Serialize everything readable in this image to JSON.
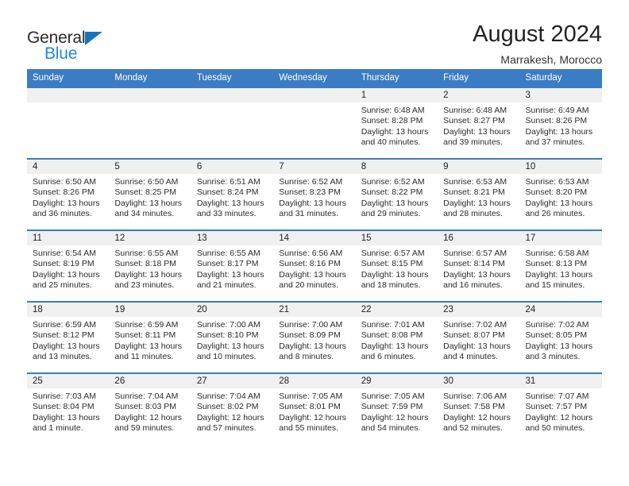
{
  "brand": {
    "name_part1": "General",
    "name_part2": "Blue",
    "logo_icon": "triangle-logo-icon"
  },
  "header": {
    "title": "August 2024",
    "location": "Marrakesh, Morocco"
  },
  "colors": {
    "header_blue": "#3b7cc4",
    "brand_blue": "#2189d6",
    "daynum_band": "#f0f0f0"
  },
  "weekday_headers": [
    "Sunday",
    "Monday",
    "Tuesday",
    "Wednesday",
    "Thursday",
    "Friday",
    "Saturday"
  ],
  "labels": {
    "sunrise_prefix": "Sunrise:",
    "sunset_prefix": "Sunset:",
    "daylight_prefix": "Daylight:"
  },
  "weeks": [
    [
      {
        "day": "",
        "empty": true
      },
      {
        "day": "",
        "empty": true
      },
      {
        "day": "",
        "empty": true
      },
      {
        "day": "",
        "empty": true
      },
      {
        "day": "1",
        "sunrise": "Sunrise: 6:48 AM",
        "sunset": "Sunset: 8:28 PM",
        "daylight1": "Daylight: 13 hours",
        "daylight2": "and 40 minutes."
      },
      {
        "day": "2",
        "sunrise": "Sunrise: 6:48 AM",
        "sunset": "Sunset: 8:27 PM",
        "daylight1": "Daylight: 13 hours",
        "daylight2": "and 39 minutes."
      },
      {
        "day": "3",
        "sunrise": "Sunrise: 6:49 AM",
        "sunset": "Sunset: 8:26 PM",
        "daylight1": "Daylight: 13 hours",
        "daylight2": "and 37 minutes."
      }
    ],
    [
      {
        "day": "4",
        "sunrise": "Sunrise: 6:50 AM",
        "sunset": "Sunset: 8:26 PM",
        "daylight1": "Daylight: 13 hours",
        "daylight2": "and 36 minutes."
      },
      {
        "day": "5",
        "sunrise": "Sunrise: 6:50 AM",
        "sunset": "Sunset: 8:25 PM",
        "daylight1": "Daylight: 13 hours",
        "daylight2": "and 34 minutes."
      },
      {
        "day": "6",
        "sunrise": "Sunrise: 6:51 AM",
        "sunset": "Sunset: 8:24 PM",
        "daylight1": "Daylight: 13 hours",
        "daylight2": "and 33 minutes."
      },
      {
        "day": "7",
        "sunrise": "Sunrise: 6:52 AM",
        "sunset": "Sunset: 8:23 PM",
        "daylight1": "Daylight: 13 hours",
        "daylight2": "and 31 minutes."
      },
      {
        "day": "8",
        "sunrise": "Sunrise: 6:52 AM",
        "sunset": "Sunset: 8:22 PM",
        "daylight1": "Daylight: 13 hours",
        "daylight2": "and 29 minutes."
      },
      {
        "day": "9",
        "sunrise": "Sunrise: 6:53 AM",
        "sunset": "Sunset: 8:21 PM",
        "daylight1": "Daylight: 13 hours",
        "daylight2": "and 28 minutes."
      },
      {
        "day": "10",
        "sunrise": "Sunrise: 6:53 AM",
        "sunset": "Sunset: 8:20 PM",
        "daylight1": "Daylight: 13 hours",
        "daylight2": "and 26 minutes."
      }
    ],
    [
      {
        "day": "11",
        "sunrise": "Sunrise: 6:54 AM",
        "sunset": "Sunset: 8:19 PM",
        "daylight1": "Daylight: 13 hours",
        "daylight2": "and 25 minutes."
      },
      {
        "day": "12",
        "sunrise": "Sunrise: 6:55 AM",
        "sunset": "Sunset: 8:18 PM",
        "daylight1": "Daylight: 13 hours",
        "daylight2": "and 23 minutes."
      },
      {
        "day": "13",
        "sunrise": "Sunrise: 6:55 AM",
        "sunset": "Sunset: 8:17 PM",
        "daylight1": "Daylight: 13 hours",
        "daylight2": "and 21 minutes."
      },
      {
        "day": "14",
        "sunrise": "Sunrise: 6:56 AM",
        "sunset": "Sunset: 8:16 PM",
        "daylight1": "Daylight: 13 hours",
        "daylight2": "and 20 minutes."
      },
      {
        "day": "15",
        "sunrise": "Sunrise: 6:57 AM",
        "sunset": "Sunset: 8:15 PM",
        "daylight1": "Daylight: 13 hours",
        "daylight2": "and 18 minutes."
      },
      {
        "day": "16",
        "sunrise": "Sunrise: 6:57 AM",
        "sunset": "Sunset: 8:14 PM",
        "daylight1": "Daylight: 13 hours",
        "daylight2": "and 16 minutes."
      },
      {
        "day": "17",
        "sunrise": "Sunrise: 6:58 AM",
        "sunset": "Sunset: 8:13 PM",
        "daylight1": "Daylight: 13 hours",
        "daylight2": "and 15 minutes."
      }
    ],
    [
      {
        "day": "18",
        "sunrise": "Sunrise: 6:59 AM",
        "sunset": "Sunset: 8:12 PM",
        "daylight1": "Daylight: 13 hours",
        "daylight2": "and 13 minutes."
      },
      {
        "day": "19",
        "sunrise": "Sunrise: 6:59 AM",
        "sunset": "Sunset: 8:11 PM",
        "daylight1": "Daylight: 13 hours",
        "daylight2": "and 11 minutes."
      },
      {
        "day": "20",
        "sunrise": "Sunrise: 7:00 AM",
        "sunset": "Sunset: 8:10 PM",
        "daylight1": "Daylight: 13 hours",
        "daylight2": "and 10 minutes."
      },
      {
        "day": "21",
        "sunrise": "Sunrise: 7:00 AM",
        "sunset": "Sunset: 8:09 PM",
        "daylight1": "Daylight: 13 hours",
        "daylight2": "and 8 minutes."
      },
      {
        "day": "22",
        "sunrise": "Sunrise: 7:01 AM",
        "sunset": "Sunset: 8:08 PM",
        "daylight1": "Daylight: 13 hours",
        "daylight2": "and 6 minutes."
      },
      {
        "day": "23",
        "sunrise": "Sunrise: 7:02 AM",
        "sunset": "Sunset: 8:07 PM",
        "daylight1": "Daylight: 13 hours",
        "daylight2": "and 4 minutes."
      },
      {
        "day": "24",
        "sunrise": "Sunrise: 7:02 AM",
        "sunset": "Sunset: 8:05 PM",
        "daylight1": "Daylight: 13 hours",
        "daylight2": "and 3 minutes."
      }
    ],
    [
      {
        "day": "25",
        "sunrise": "Sunrise: 7:03 AM",
        "sunset": "Sunset: 8:04 PM",
        "daylight1": "Daylight: 13 hours",
        "daylight2": "and 1 minute."
      },
      {
        "day": "26",
        "sunrise": "Sunrise: 7:04 AM",
        "sunset": "Sunset: 8:03 PM",
        "daylight1": "Daylight: 12 hours",
        "daylight2": "and 59 minutes."
      },
      {
        "day": "27",
        "sunrise": "Sunrise: 7:04 AM",
        "sunset": "Sunset: 8:02 PM",
        "daylight1": "Daylight: 12 hours",
        "daylight2": "and 57 minutes."
      },
      {
        "day": "28",
        "sunrise": "Sunrise: 7:05 AM",
        "sunset": "Sunset: 8:01 PM",
        "daylight1": "Daylight: 12 hours",
        "daylight2": "and 55 minutes."
      },
      {
        "day": "29",
        "sunrise": "Sunrise: 7:05 AM",
        "sunset": "Sunset: 7:59 PM",
        "daylight1": "Daylight: 12 hours",
        "daylight2": "and 54 minutes."
      },
      {
        "day": "30",
        "sunrise": "Sunrise: 7:06 AM",
        "sunset": "Sunset: 7:58 PM",
        "daylight1": "Daylight: 12 hours",
        "daylight2": "and 52 minutes."
      },
      {
        "day": "31",
        "sunrise": "Sunrise: 7:07 AM",
        "sunset": "Sunset: 7:57 PM",
        "daylight1": "Daylight: 12 hours",
        "daylight2": "and 50 minutes."
      }
    ]
  ]
}
